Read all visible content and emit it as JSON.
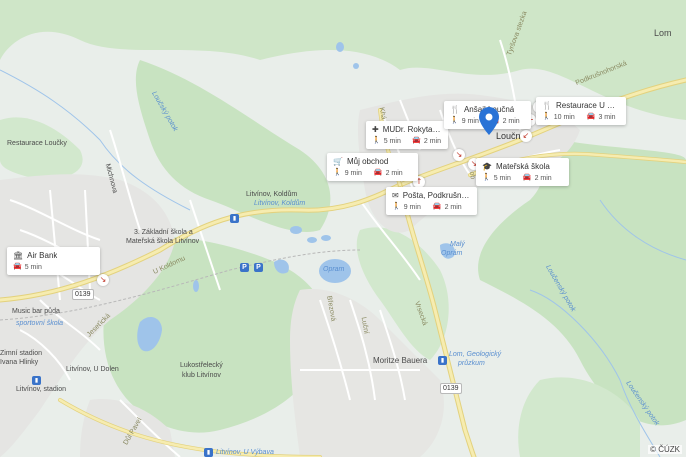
{
  "map": {
    "attribution": "© ČÚZK",
    "colors": {
      "base": "#e9eeea",
      "forest": "#c8e3c1",
      "urban": "#e6e6e6",
      "water": "#9fc4ea",
      "road": "#f3e8a8",
      "road_edge": "#e3d27e",
      "marker": "#2a73d6"
    },
    "place_labels": {
      "restaurace_loucky": "Restaurace Loučky",
      "michnova": "Michnova",
      "zakladni_skola": "3. Základní škola a",
      "materska_skola_litvinov": "Mateřská škola Litvínov",
      "litvinov_koldum": "Litvínov, Koldům",
      "litvinov_koldum_stop": "Litvínov, Koldům",
      "u_koldomu": "U Koldomu",
      "jeseticka": "Jeseťická",
      "music_bar": "Music bar půda",
      "sportovni_skola": "sportovní škola",
      "zimni_stadion": "Zimní stadion",
      "ivana_hlinky": "Ivana Hlinky",
      "litvinov_u_dolen": "Litvínov, U Dolen",
      "litvinov_stadion": "Litvínov, stadion",
      "oprám": "Opram",
      "brezova": "Březová",
      "lucni": "Luční",
      "moritze_bauera": "Moritze Bauera",
      "lom_geologicky": "Lom, Geologický",
      "pruzkum": "průzkum",
      "lukostrelecky": "Lukostřelecký",
      "klub_litvinov": "klub Litvínov",
      "dul_pavel": "Důl Pavel",
      "litvinov_u_vybava": "Litvínov, U Výbava",
      "maly_opram": "Malý",
      "maly_opram2": "Oprám",
      "vrsecka": "Vrsecká",
      "podkrusnohorska": "Podkrušnohorská",
      "tyrsova": "Tyršova stezka",
      "loucky_potok": "Loučský potok",
      "loucensky_potok": "Loučenský potok",
      "loucensky_potok2": "Loučenský potok",
      "loucna": "Loučná",
      "khaj": "Khá",
      "lom": "Lom",
      "ob": "ob"
    },
    "road_shields": {
      "a": "0139",
      "b": "0139"
    },
    "pois": [
      {
        "id": "air_bank",
        "name": "Air Bank",
        "icon": "bank-icon",
        "car": "5 min"
      },
      {
        "id": "mudr_rokyta",
        "name": "MUDr. Rokyta Jan",
        "icon": "medical-icon",
        "walk": "5 min",
        "car": "2 min"
      },
      {
        "id": "muj_obchod",
        "name": "Můj obchod",
        "icon": "cart-icon",
        "walk": "9 min",
        "car": "2 min"
      },
      {
        "id": "ansajl",
        "name": "Anšajl Loučná",
        "icon": "restaurant-icon",
        "walk": "9 min",
        "car": "2 min"
      },
      {
        "id": "restaurace_u_tys",
        "name": "Restaurace U Tyš…",
        "icon": "restaurant-icon",
        "walk": "10 min",
        "car": "3 min"
      },
      {
        "id": "materska_skola",
        "name": "Mateřská škola",
        "icon": "school-icon",
        "walk": "5 min",
        "car": "2 min"
      },
      {
        "id": "posta",
        "name": "Pošta, Podkrušno…",
        "icon": "post-icon",
        "walk": "9 min",
        "car": "2 min"
      }
    ]
  }
}
